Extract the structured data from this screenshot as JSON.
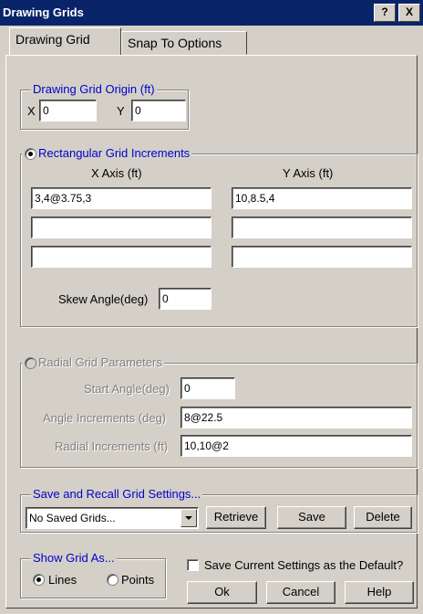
{
  "window": {
    "title": "Drawing Grids",
    "help_btn": "?",
    "close_btn": "X"
  },
  "tabs": [
    {
      "label": "Drawing Grid"
    },
    {
      "label": "Snap To Options"
    }
  ],
  "origin": {
    "legend": "Drawing Grid Origin (ft)",
    "x_label": "X",
    "x_value": "0",
    "y_label": "Y",
    "y_value": "0"
  },
  "rect": {
    "legend": "Rectangular Grid Increments",
    "selected": true,
    "x_axis_label": "X Axis (ft)",
    "y_axis_label": "Y Axis (ft)",
    "x_values": [
      "3,4@3.75,3",
      "",
      ""
    ],
    "y_values": [
      "10,8.5,4",
      "",
      ""
    ],
    "skew_label": "Skew Angle(deg)",
    "skew_value": "0"
  },
  "radial": {
    "legend": "Radial Grid Parameters",
    "selected": false,
    "start_label": "Start Angle(deg)",
    "start_value": "0",
    "angle_label": "Angle Increments (deg)",
    "angle_value": "8@22.5",
    "radial_label": "Radial Increments (ft)",
    "radial_value": "10,10@2"
  },
  "save_recall": {
    "legend": "Save and Recall Grid Settings...",
    "dropdown_value": "No Saved Grids...",
    "retrieve": "Retrieve",
    "save": "Save",
    "delete": "Delete"
  },
  "show_grid": {
    "legend": "Show Grid As...",
    "lines": "Lines",
    "points": "Points",
    "selected": "Lines"
  },
  "default_checkbox": {
    "label": "Save Current Settings as the Default?",
    "checked": false
  },
  "dialog_buttons": {
    "ok": "Ok",
    "cancel": "Cancel",
    "help": "Help"
  },
  "colors": {
    "title_bg": "#0a246a",
    "group_legend": "#0000cc",
    "face": "#d4d0c8"
  }
}
